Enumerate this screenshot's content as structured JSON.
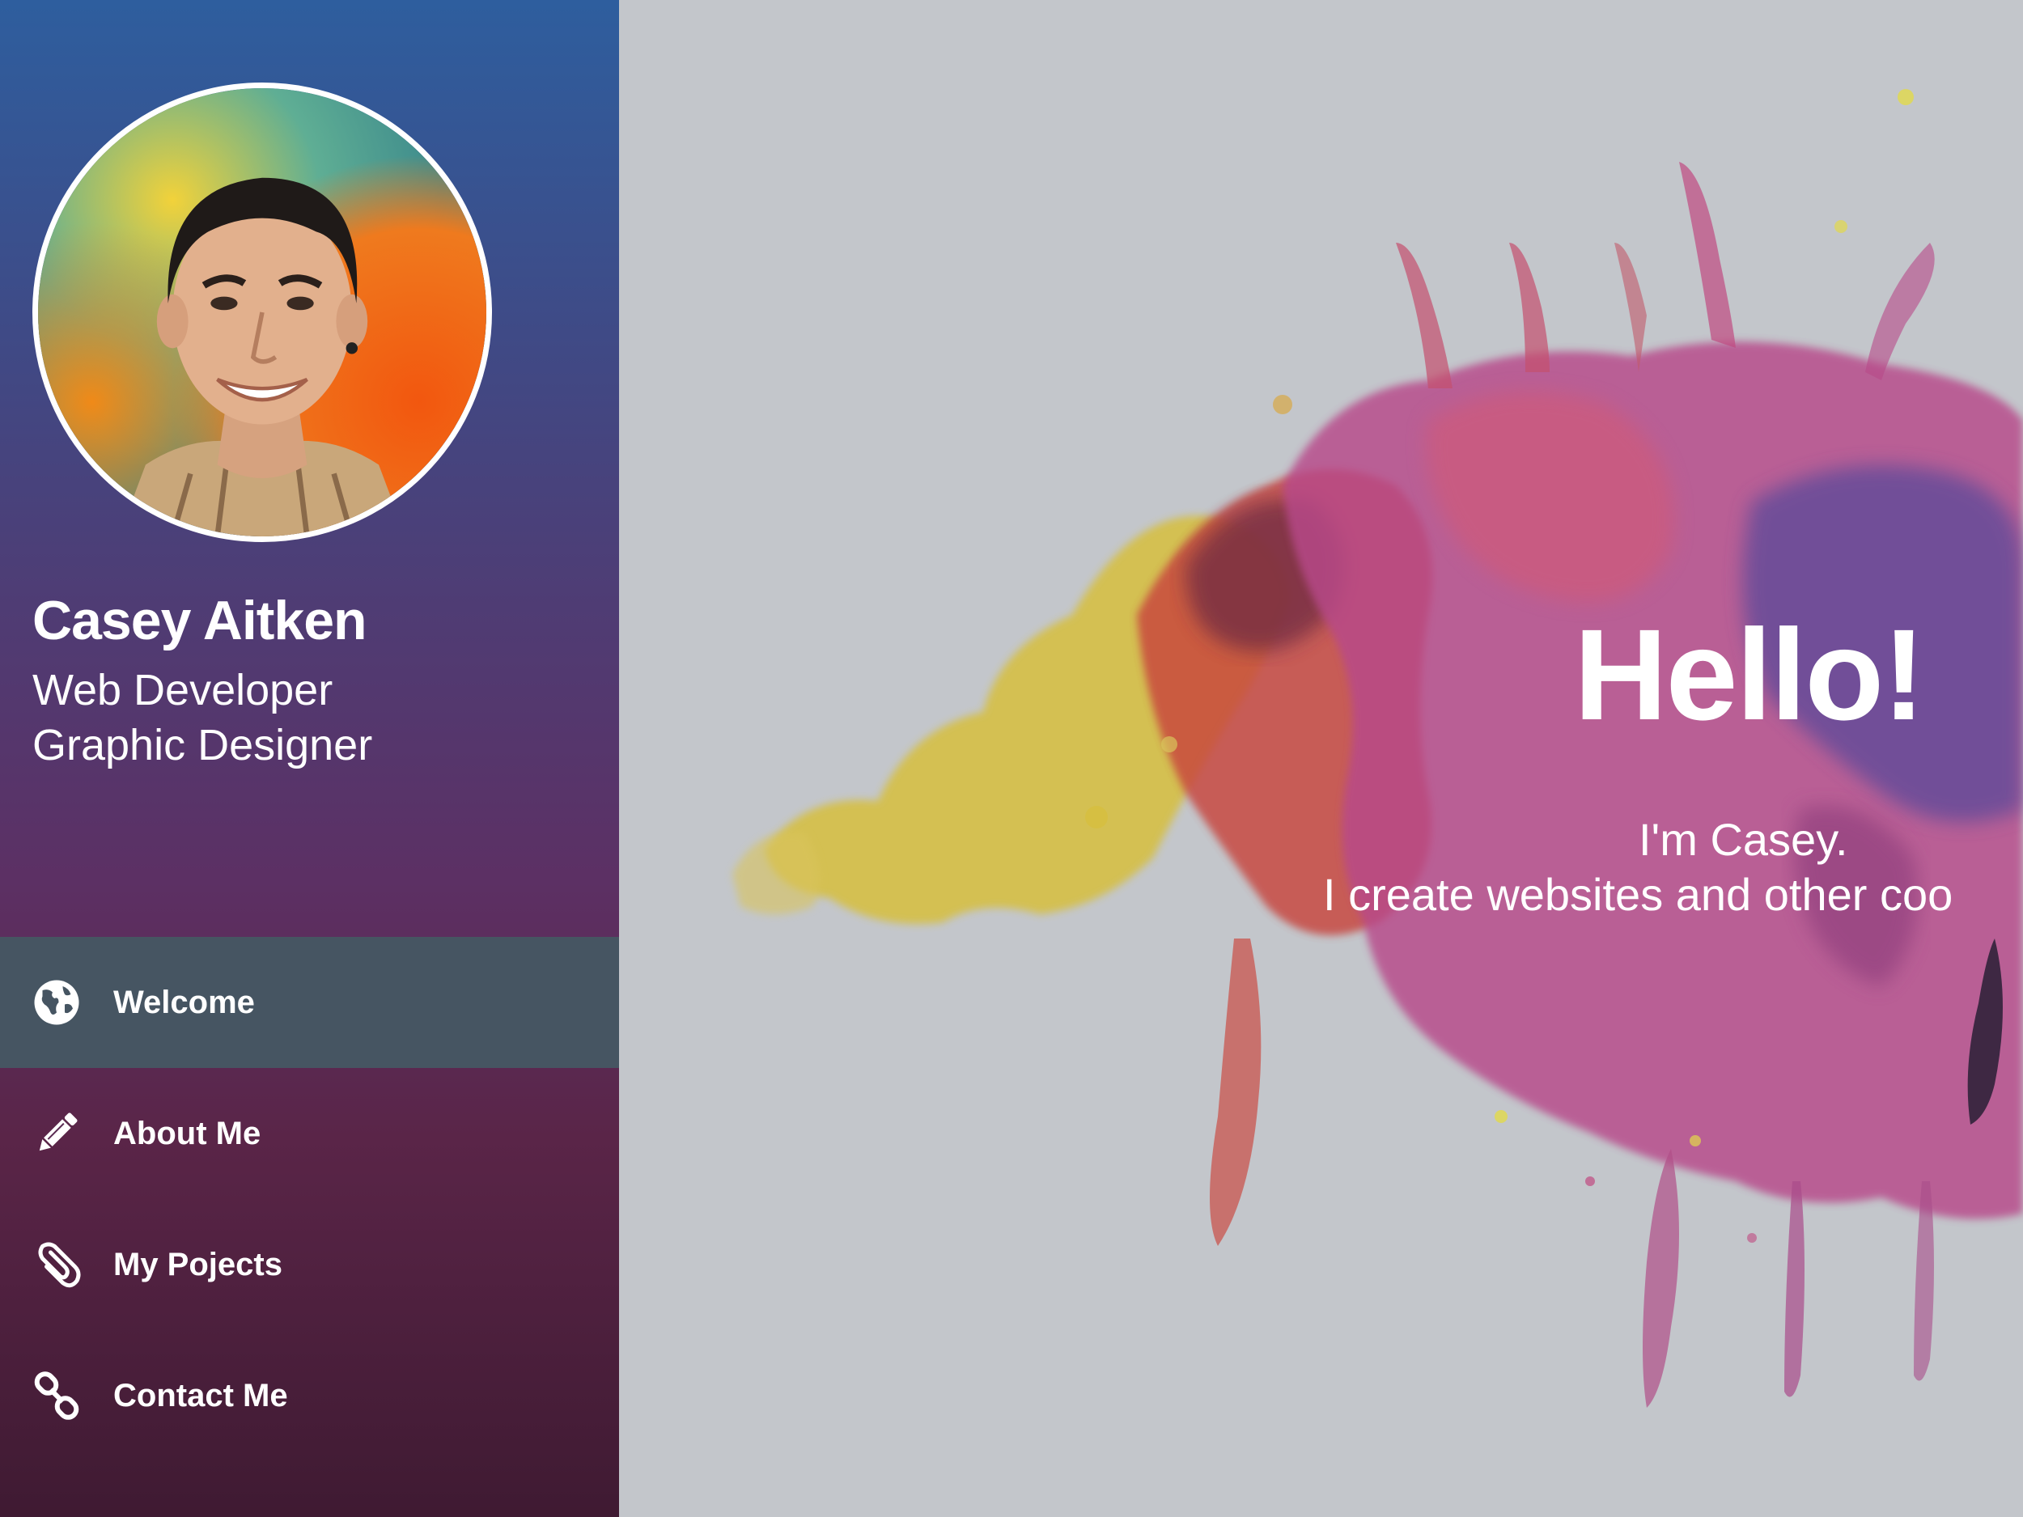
{
  "profile": {
    "name": "Casey Aitken",
    "roles": [
      "Web Developer",
      "Graphic Designer"
    ]
  },
  "nav": {
    "items": [
      {
        "label": "Welcome",
        "icon": "globe-icon",
        "active": true
      },
      {
        "label": "About Me",
        "icon": "pencil-icon",
        "active": false
      },
      {
        "label": "My Pojects",
        "icon": "paperclip-icon",
        "active": false
      },
      {
        "label": "Contact Me",
        "icon": "chain-link-icon",
        "active": false
      }
    ]
  },
  "hero": {
    "title": "Hello!",
    "line1": "I'm Casey.",
    "line2": "I create websites and other coo"
  },
  "colors": {
    "sidebar_top": "#2e5e9e",
    "sidebar_bottom": "#3f1a32",
    "active_item": "#465562",
    "background": "#c3c6cb"
  }
}
